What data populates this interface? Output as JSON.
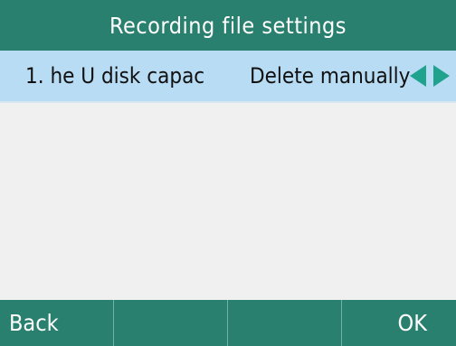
{
  "title": "Recording file settings",
  "setting_row": {
    "label": "1. he U disk capac",
    "value": "Delete manually"
  },
  "softkeys": [
    {
      "label": "Back"
    },
    {
      "label": ""
    },
    {
      "label": ""
    },
    {
      "label": "OK"
    }
  ],
  "colors": {
    "bar": "#29806f",
    "selected_row": "#b8dcf4",
    "arrow": "#1fa38f",
    "background": "#f0f0f0"
  },
  "icons": {
    "prev": "left-arrow-icon",
    "next": "right-arrow-icon"
  }
}
